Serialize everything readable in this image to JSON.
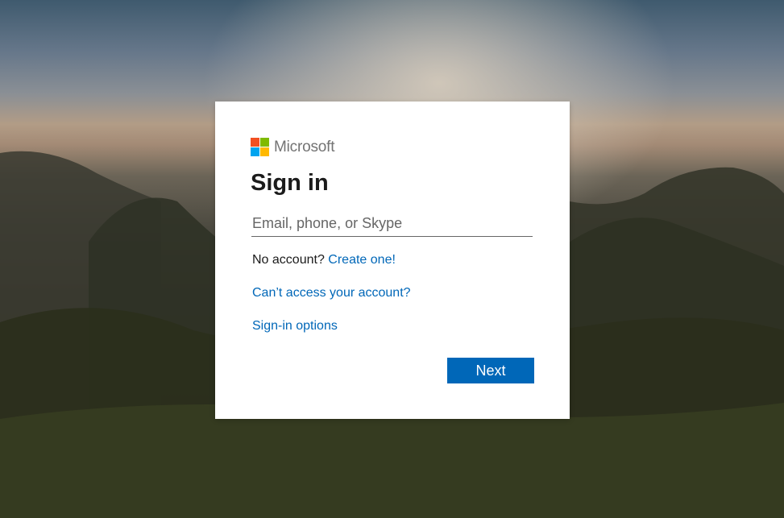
{
  "brand": {
    "name": "Microsoft",
    "logo_colors": [
      "#f25022",
      "#7fba00",
      "#00a4ef",
      "#ffb900"
    ]
  },
  "colors": {
    "accent": "#0067b8",
    "text": "#1b1b1b",
    "card_background": "#ffffff"
  },
  "form": {
    "title": "Sign in",
    "email": {
      "placeholder": "Email, phone, or Skype",
      "value": ""
    },
    "no_account_text": "No account?",
    "create_link": "Create one!",
    "cant_access_link": "Can’t access your account?",
    "signin_options_link": "Sign-in options",
    "next_label": "Next"
  }
}
